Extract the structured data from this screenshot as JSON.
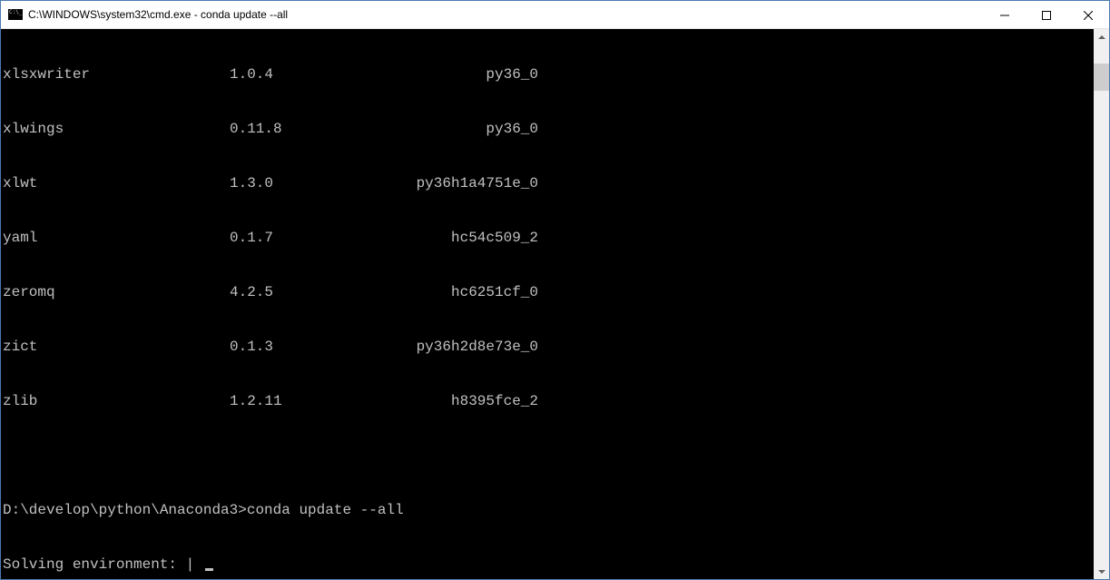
{
  "window": {
    "title": "C:\\WINDOWS\\system32\\cmd.exe - conda  update --all"
  },
  "packages": [
    {
      "name": "xlsxwriter",
      "version": "1.0.4",
      "build": "py36_0"
    },
    {
      "name": "xlwings",
      "version": "0.11.8",
      "build": "py36_0"
    },
    {
      "name": "xlwt",
      "version": "1.3.0",
      "build": "py36h1a4751e_0"
    },
    {
      "name": "yaml",
      "version": "0.1.7",
      "build": "hc54c509_2"
    },
    {
      "name": "zeromq",
      "version": "4.2.5",
      "build": "hc6251cf_0"
    },
    {
      "name": "zict",
      "version": "0.1.3",
      "build": "py36h2d8e73e_0"
    },
    {
      "name": "zlib",
      "version": "1.2.11",
      "build": "h8395fce_2"
    }
  ],
  "prompt": {
    "path": "D:\\develop\\python\\Anaconda3>",
    "command": "conda update --all"
  },
  "status": {
    "label": "Solving environment: ",
    "spinner": "|"
  }
}
